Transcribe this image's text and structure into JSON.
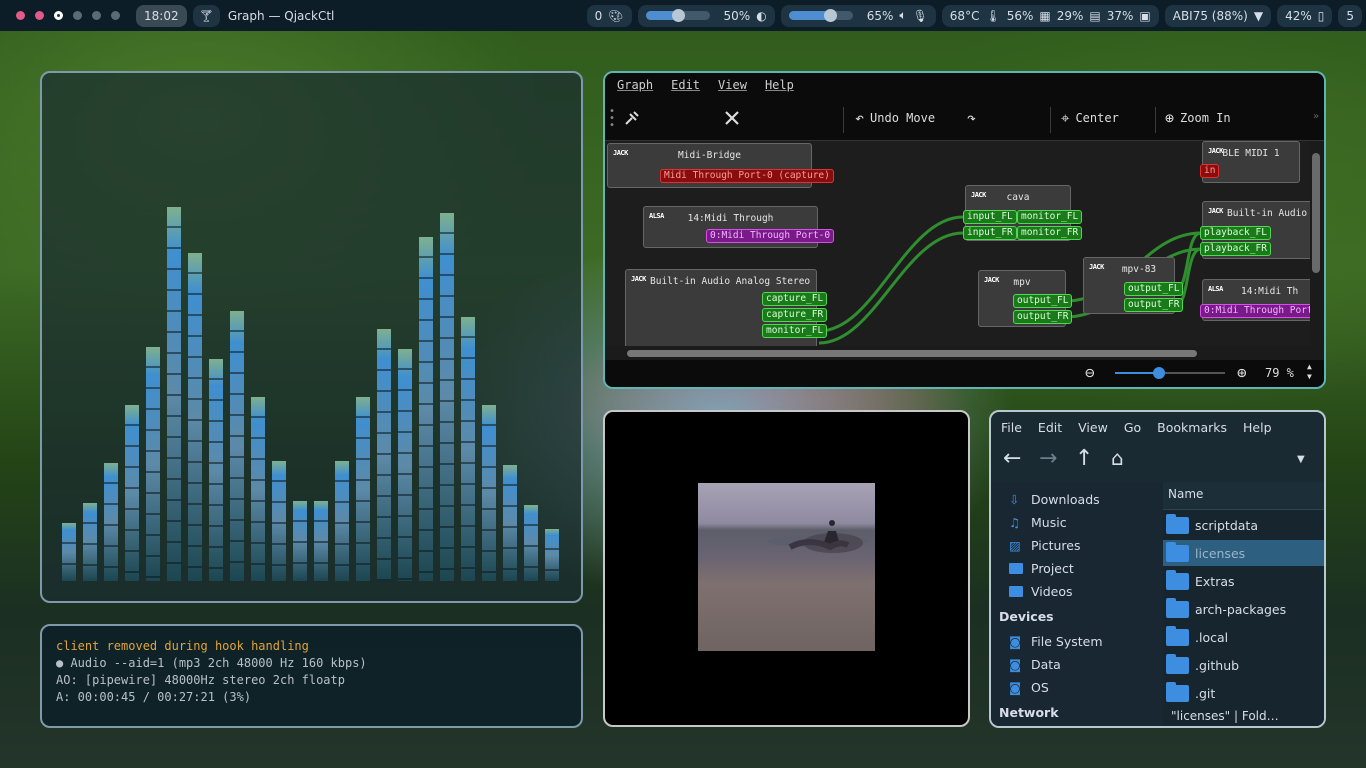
{
  "topbar": {
    "workspace_dots": [
      "#e05a8a",
      "#e05a8a",
      "#ffffff",
      "#5a6b78",
      "#5a6b78",
      "#5a6b78"
    ],
    "clock": "18:02",
    "window_icon": "cocktail-glass-icon",
    "window_title": "Graph — QjackCtl",
    "notifications": "0",
    "volume_percent": "50%",
    "volume_level": 0.5,
    "mic_percent": "65%",
    "mic_level": 0.65,
    "temperature": "68°C",
    "cpu": "56%",
    "ram": "29%",
    "gpu": "37%",
    "wifi": "ABI75 (88%)",
    "battery": "42%",
    "workspace_count": "5"
  },
  "cava": {
    "bar_levels": [
      0.145,
      0.195,
      0.295,
      0.44,
      0.585,
      0.935,
      0.82,
      0.555,
      0.675,
      0.46,
      0.3,
      0.2,
      0.2,
      0.3,
      0.46,
      0.63,
      0.58,
      0.86,
      0.92,
      0.66,
      0.44,
      0.29,
      0.19,
      0.13
    ],
    "colors": {
      "top": "#7fb08f",
      "mid": "#3f8fd0",
      "bottom": "#1c4650"
    }
  },
  "mpv_terminal": {
    "line1": "client removed during hook handling",
    "line2": "● Audio  --aid=1  (mp3 2ch 48000 Hz 160 kbps)",
    "line3": "AO: [pipewire] 48000Hz stereo 2ch floatp",
    "line4": "A: 00:00:45 / 00:27:21 (3%)"
  },
  "qjackctl": {
    "menu": [
      "Graph",
      "Edit",
      "View",
      "Help"
    ],
    "toolbar": {
      "connect_icon": "connect-icon",
      "disconnect_icon": "disconnect-icon",
      "undo_label": "Undo Move",
      "redo_icon": "redo-icon",
      "center_label": "Center",
      "zoom_in_label": "Zoom In"
    },
    "nodes": {
      "midi_bridge": {
        "title": "Midi-Bridge",
        "logo": "JACK",
        "ports": [
          "Midi Through Port-0 (capture)"
        ]
      },
      "midi_through": {
        "title": "14:Midi Through",
        "logo": "ALSA",
        "ports": [
          "0:Midi Through Port-0"
        ]
      },
      "builtin_capture": {
        "title": "Built-in Audio Analog Stereo",
        "logo": "JACK",
        "ports": [
          "capture_FL",
          "capture_FR",
          "monitor_FL"
        ]
      },
      "cava": {
        "title": "cava",
        "logo": "JACK",
        "ports_in": [
          "input_FL",
          "input_FR"
        ],
        "ports_out": [
          "monitor_FL",
          "monitor_FR"
        ]
      },
      "mpv": {
        "title": "mpv",
        "logo": "JACK",
        "ports": [
          "output_FL",
          "output_FR"
        ]
      },
      "mpv83": {
        "title": "mpv-83",
        "logo": "JACK",
        "ports": [
          "output_FL",
          "output_FR"
        ]
      },
      "ble_midi": {
        "title": "BLE MIDI 1",
        "logo": "JACK",
        "ports": [
          "in"
        ]
      },
      "builtin_playback": {
        "title": "Built-in Audio",
        "logo": "JACK",
        "ports": [
          "playback_FL",
          "playback_FR"
        ]
      },
      "midi_through_right": {
        "title": "14:Midi Th",
        "logo": "ALSA",
        "ports": [
          "0:Midi Through Port-"
        ]
      }
    },
    "zoom": "79 %",
    "zoom_level": 0.4
  },
  "file_manager": {
    "menu": [
      "File",
      "Edit",
      "View",
      "Go",
      "Bookmarks",
      "Help"
    ],
    "places": [
      "Downloads",
      "Music",
      "Pictures",
      "Project",
      "Videos"
    ],
    "devices_header": "Devices",
    "devices": [
      "File System",
      "Data",
      "OS"
    ],
    "network_header": "Network",
    "column_header": "Name",
    "files": [
      "scriptdata",
      "licenses",
      "Extras",
      "arch-packages",
      ".local",
      ".github",
      ".git"
    ],
    "selected_file": "licenses",
    "status": "\"licenses\"   |   Fold…"
  }
}
